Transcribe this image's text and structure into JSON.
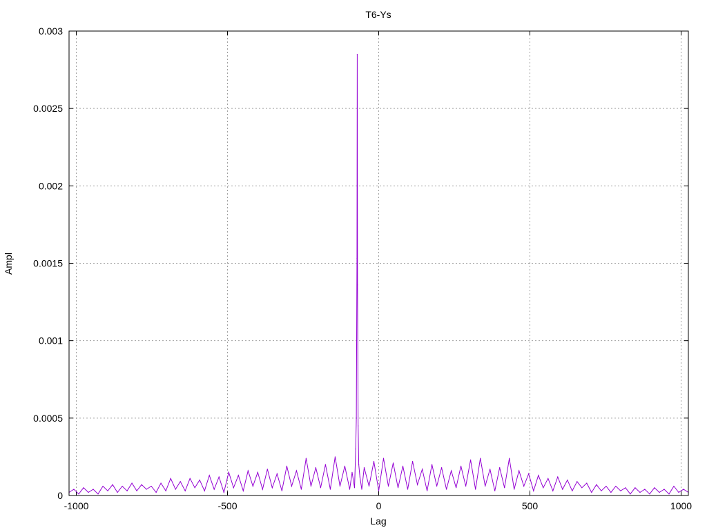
{
  "chart_data": {
    "type": "line",
    "title": "T6-Ys",
    "xlabel": "Lag",
    "ylabel": "Ampl",
    "xlim": [
      -1024,
      1024
    ],
    "ylim": [
      0,
      0.003
    ],
    "grid": true,
    "xticks": [
      -1000,
      -500,
      0,
      500,
      1000
    ],
    "xtick_labels": [
      "-1000",
      "-500",
      "0",
      "500",
      "1000"
    ],
    "yticks": [
      0,
      0.0005,
      0.001,
      0.0015,
      0.002,
      0.0025,
      0.003
    ],
    "ytick_labels": [
      "0",
      "0.0005",
      "0.001",
      "0.0015",
      "0.002",
      "0.0025",
      "0.003"
    ],
    "series": [
      {
        "name": "T6-Ys",
        "color": "#9400d3",
        "x": [
          -1024,
          -1008,
          -992,
          -976,
          -960,
          -944,
          -928,
          -912,
          -896,
          -880,
          -864,
          -848,
          -832,
          -816,
          -800,
          -784,
          -768,
          -752,
          -736,
          -720,
          -704,
          -688,
          -672,
          -656,
          -640,
          -624,
          -608,
          -592,
          -576,
          -560,
          -544,
          -528,
          -512,
          -496,
          -480,
          -464,
          -448,
          -432,
          -416,
          -400,
          -384,
          -368,
          -352,
          -336,
          -320,
          -304,
          -288,
          -272,
          -256,
          -240,
          -224,
          -208,
          -192,
          -176,
          -160,
          -144,
          -128,
          -112,
          -96,
          -88,
          -80,
          -76,
          -74,
          -72,
          -71,
          -70,
          -68,
          -66,
          -62,
          -56,
          -48,
          -32,
          -16,
          0,
          16,
          32,
          48,
          64,
          80,
          96,
          112,
          128,
          144,
          160,
          176,
          192,
          208,
          224,
          240,
          256,
          272,
          288,
          304,
          320,
          336,
          352,
          368,
          384,
          400,
          416,
          432,
          448,
          464,
          480,
          496,
          512,
          528,
          544,
          560,
          576,
          592,
          608,
          624,
          640,
          656,
          672,
          688,
          704,
          720,
          736,
          752,
          768,
          784,
          800,
          816,
          832,
          848,
          864,
          880,
          896,
          912,
          928,
          944,
          960,
          976,
          992,
          1008,
          1024
        ],
        "y": [
          2e-05,
          4e-05,
          1e-05,
          5e-05,
          2e-05,
          4e-05,
          1e-05,
          6e-05,
          3e-05,
          7e-05,
          2e-05,
          6e-05,
          3e-05,
          8e-05,
          3e-05,
          7e-05,
          4e-05,
          6e-05,
          2e-05,
          8e-05,
          3e-05,
          0.00011,
          4e-05,
          9e-05,
          3e-05,
          0.00011,
          5e-05,
          0.0001,
          3e-05,
          0.00013,
          4e-05,
          0.00012,
          2e-05,
          0.00015,
          5e-05,
          0.00013,
          3e-05,
          0.00016,
          6e-05,
          0.00015,
          4e-05,
          0.00017,
          5e-05,
          0.00014,
          3e-05,
          0.00019,
          6e-05,
          0.00016,
          4e-05,
          0.00024,
          6e-05,
          0.00018,
          5e-05,
          0.0002,
          4e-05,
          0.00025,
          6e-05,
          0.00019,
          4e-05,
          0.00015,
          5e-05,
          0.0003,
          0.0005,
          0.00153,
          0.00285,
          0.00136,
          0.00045,
          0.0002,
          0.00012,
          4e-05,
          0.00018,
          6e-05,
          0.00022,
          3e-05,
          0.00024,
          6e-05,
          0.00021,
          5e-05,
          0.00019,
          4e-05,
          0.00022,
          7e-05,
          0.00017,
          3e-05,
          0.0002,
          6e-05,
          0.00018,
          4e-05,
          0.00016,
          5e-05,
          0.00019,
          6e-05,
          0.00023,
          4e-05,
          0.00024,
          6e-05,
          0.00017,
          3e-05,
          0.00018,
          5e-05,
          0.00024,
          4e-05,
          0.00016,
          6e-05,
          0.00014,
          3e-05,
          0.00013,
          5e-05,
          0.00011,
          3e-05,
          0.00012,
          4e-05,
          0.0001,
          3e-05,
          9e-05,
          5e-05,
          8e-05,
          2e-05,
          7e-05,
          3e-05,
          6e-05,
          2e-05,
          6e-05,
          3e-05,
          5e-05,
          1e-05,
          5e-05,
          2e-05,
          4e-05,
          1e-05,
          5e-05,
          2e-05,
          4e-05,
          1e-05,
          6e-05,
          2e-05,
          4e-05,
          2e-05
        ]
      }
    ]
  }
}
